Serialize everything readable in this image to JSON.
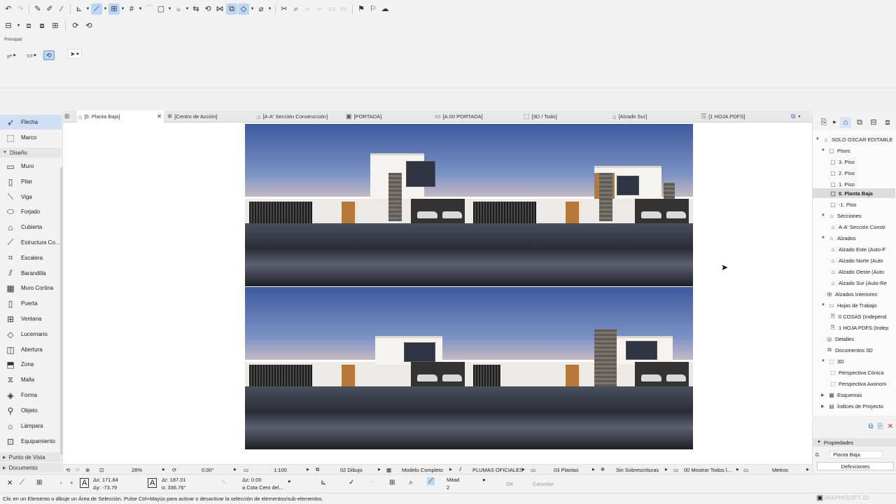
{
  "toolbar": {
    "undo_icon": "undo-icon",
    "redo_icon": "redo-icon"
  },
  "info_box": {
    "label": "Principal:"
  },
  "toolbox": {
    "select_tools": [
      {
        "label": "Flecha",
        "icon": "arrow-icon"
      },
      {
        "label": "Marco",
        "icon": "marquee-icon"
      }
    ],
    "design_section": "Diseño",
    "design_tools": [
      {
        "label": "Muro"
      },
      {
        "label": "Pilar"
      },
      {
        "label": "Viga"
      },
      {
        "label": "Forjado"
      },
      {
        "label": "Cubierta"
      },
      {
        "label": "Estructura Co..."
      },
      {
        "label": "Escalera"
      },
      {
        "label": "Barandilla"
      },
      {
        "label": "Muro Cortina"
      },
      {
        "label": "Puerta"
      },
      {
        "label": "Ventana"
      },
      {
        "label": "Lucernario"
      },
      {
        "label": "Abertura"
      },
      {
        "label": "Zona"
      },
      {
        "label": "Malla"
      },
      {
        "label": "Forma"
      },
      {
        "label": "Objeto"
      },
      {
        "label": "Lámpara"
      },
      {
        "label": "Equipamiento"
      }
    ],
    "viewpoint_section": "Punto de Vista",
    "document_section": "Documento"
  },
  "tabs": [
    {
      "label": "[0. Planta Baja]"
    },
    {
      "label": "[Centro de Acción]"
    },
    {
      "label": "[A-A' Sección Construcción]"
    },
    {
      "label": "[PORTADA]"
    },
    {
      "label": "[A.00 PORTADA]"
    },
    {
      "label": "[3D / Todo]"
    },
    {
      "label": "[Alzado Sur]"
    },
    {
      "label": "[1 HOJA PDFS]"
    }
  ],
  "navigator": {
    "root": "SOLO OSCAR EDITABLE",
    "items": [
      {
        "label": "Pisos"
      },
      {
        "label": "3. Piso"
      },
      {
        "label": "2. Piso"
      },
      {
        "label": "1. Piso"
      },
      {
        "label": "0. Planta Baja"
      },
      {
        "label": "-1. Piso"
      },
      {
        "label": "Secciones"
      },
      {
        "label": "A-A' Sección Constr"
      },
      {
        "label": "Alzados"
      },
      {
        "label": "Alzado Este (Auto-F"
      },
      {
        "label": "Alzado Norte (Auto"
      },
      {
        "label": "Alzado Oeste (Auto"
      },
      {
        "label": "Alzado Sur (Auto-Re"
      },
      {
        "label": "Alzados Interiores"
      },
      {
        "label": "Hojas de Trabajo"
      },
      {
        "label": "0 COSAS (Independ"
      },
      {
        "label": "1 HOJA PDFS (Indep"
      },
      {
        "label": "Detalles"
      },
      {
        "label": "Documentos 3D"
      },
      {
        "label": "3D"
      },
      {
        "label": "Perspectiva Cónica"
      },
      {
        "label": "Perspectiva Axonom"
      },
      {
        "label": "Esquemas"
      },
      {
        "label": "Índices de Proyecto"
      }
    ]
  },
  "properties": {
    "header": "Propiedades",
    "story_num": "0.",
    "story_name": "Planta Baja",
    "definitions_button": "Definiciones"
  },
  "quick_options": {
    "zoom": "28%",
    "angle": "0.00°",
    "scale": "1:100",
    "layer_combo": "02 Dibujo",
    "model_view": "Modelo Completo",
    "pen_set": "PLUMAS OFICIALES",
    "graphic_override": "03 Plantas",
    "renovation": "Sin Sobrescrituras",
    "structure_display": "00 Mostrar Todos l...",
    "units": "Metros"
  },
  "info_bar": {
    "dx": "Δx: 171.84",
    "dy": "Δy: -73.79",
    "dr": "Δr: 187.01",
    "angle": "α: 336.76°",
    "dz": "Δz: 0.00",
    "ref": "a Cota Cero del...",
    "mid_label": "Mitad",
    "mid_value": "2",
    "ok": "OK",
    "cancel": "Cancelar"
  },
  "status": {
    "message": "Clic en un Elemento o dibuje un Área de Selección. Pulse Ctrl+Mayús para activar o desactivar la selección de elementos/sub-elementos.",
    "brand": "GRAPHISOFT ID"
  }
}
